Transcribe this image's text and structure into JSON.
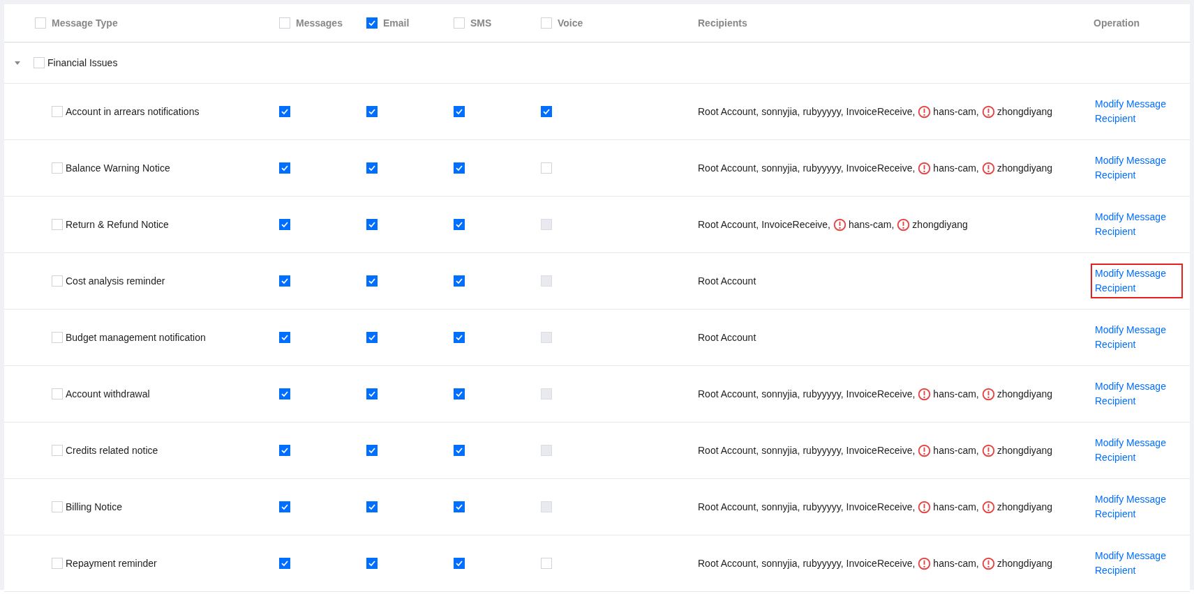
{
  "header": {
    "type": {
      "label": "Message Type",
      "checked": false
    },
    "channels": [
      {
        "label": "Messages",
        "checked": false
      },
      {
        "label": "Email",
        "checked": true
      },
      {
        "label": "SMS",
        "checked": false
      },
      {
        "label": "Voice",
        "checked": false
      }
    ],
    "recipients": "Recipients",
    "operation": "Operation"
  },
  "groups": [
    {
      "label": "Financial Issues",
      "expanded": true,
      "checked": false,
      "rows": [
        {
          "label": "Account in arrears notifications",
          "checked": false,
          "channels": [
            {
              "checked": true,
              "disabled": false
            },
            {
              "checked": true,
              "disabled": false
            },
            {
              "checked": true,
              "disabled": false
            },
            {
              "checked": true,
              "disabled": false
            }
          ],
          "recipients": [
            {
              "name": "Root Account,",
              "warning": false
            },
            {
              "name": "sonnyjia,",
              "warning": false
            },
            {
              "name": "rubyyyyy,",
              "warning": false
            },
            {
              "name": "InvoiceReceive,",
              "warning": false
            },
            {
              "name": "hans-cam,",
              "warning": true
            },
            {
              "name": "zhongdiyang",
              "warning": true
            }
          ],
          "operation": {
            "label": "Modify Message Recipient",
            "highlighted": false
          }
        },
        {
          "label": "Balance Warning Notice",
          "checked": false,
          "channels": [
            {
              "checked": true,
              "disabled": false
            },
            {
              "checked": true,
              "disabled": false
            },
            {
              "checked": true,
              "disabled": false
            },
            {
              "checked": false,
              "disabled": false
            }
          ],
          "recipients": [
            {
              "name": "Root Account,",
              "warning": false
            },
            {
              "name": "sonnyjia,",
              "warning": false
            },
            {
              "name": "rubyyyyy,",
              "warning": false
            },
            {
              "name": "InvoiceReceive,",
              "warning": false
            },
            {
              "name": "hans-cam,",
              "warning": true
            },
            {
              "name": "zhongdiyang",
              "warning": true
            }
          ],
          "operation": {
            "label": "Modify Message Recipient",
            "highlighted": false
          }
        },
        {
          "label": "Return & Refund Notice",
          "checked": false,
          "channels": [
            {
              "checked": true,
              "disabled": false
            },
            {
              "checked": true,
              "disabled": false
            },
            {
              "checked": true,
              "disabled": false
            },
            {
              "checked": false,
              "disabled": true
            }
          ],
          "recipients": [
            {
              "name": "Root Account,",
              "warning": false
            },
            {
              "name": "InvoiceReceive,",
              "warning": false
            },
            {
              "name": "hans-cam,",
              "warning": true
            },
            {
              "name": "zhongdiyang",
              "warning": true
            }
          ],
          "operation": {
            "label": "Modify Message Recipient",
            "highlighted": false
          }
        },
        {
          "label": "Cost analysis reminder",
          "checked": false,
          "channels": [
            {
              "checked": true,
              "disabled": false
            },
            {
              "checked": true,
              "disabled": false
            },
            {
              "checked": true,
              "disabled": false
            },
            {
              "checked": false,
              "disabled": true
            }
          ],
          "recipients": [
            {
              "name": "Root Account",
              "warning": false
            }
          ],
          "operation": {
            "label": "Modify Message Recipient",
            "highlighted": true
          }
        },
        {
          "label": "Budget management notification",
          "checked": false,
          "channels": [
            {
              "checked": true,
              "disabled": false
            },
            {
              "checked": true,
              "disabled": false
            },
            {
              "checked": true,
              "disabled": false
            },
            {
              "checked": false,
              "disabled": true
            }
          ],
          "recipients": [
            {
              "name": "Root Account",
              "warning": false
            }
          ],
          "operation": {
            "label": "Modify Message Recipient",
            "highlighted": false
          }
        },
        {
          "label": "Account withdrawal",
          "checked": false,
          "channels": [
            {
              "checked": true,
              "disabled": false
            },
            {
              "checked": true,
              "disabled": false
            },
            {
              "checked": true,
              "disabled": false
            },
            {
              "checked": false,
              "disabled": true
            }
          ],
          "recipients": [
            {
              "name": "Root Account,",
              "warning": false
            },
            {
              "name": "sonnyjia,",
              "warning": false
            },
            {
              "name": "rubyyyyy,",
              "warning": false
            },
            {
              "name": "InvoiceReceive,",
              "warning": false
            },
            {
              "name": "hans-cam,",
              "warning": true
            },
            {
              "name": "zhongdiyang",
              "warning": true
            }
          ],
          "operation": {
            "label": "Modify Message Recipient",
            "highlighted": false
          }
        },
        {
          "label": "Credits related notice",
          "checked": false,
          "channels": [
            {
              "checked": true,
              "disabled": false
            },
            {
              "checked": true,
              "disabled": false
            },
            {
              "checked": true,
              "disabled": false
            },
            {
              "checked": false,
              "disabled": true
            }
          ],
          "recipients": [
            {
              "name": "Root Account,",
              "warning": false
            },
            {
              "name": "sonnyjia,",
              "warning": false
            },
            {
              "name": "rubyyyyy,",
              "warning": false
            },
            {
              "name": "InvoiceReceive,",
              "warning": false
            },
            {
              "name": "hans-cam,",
              "warning": true
            },
            {
              "name": "zhongdiyang",
              "warning": true
            }
          ],
          "operation": {
            "label": "Modify Message Recipient",
            "highlighted": false
          }
        },
        {
          "label": "Billing Notice",
          "checked": false,
          "channels": [
            {
              "checked": true,
              "disabled": false
            },
            {
              "checked": true,
              "disabled": false
            },
            {
              "checked": true,
              "disabled": false
            },
            {
              "checked": false,
              "disabled": true
            }
          ],
          "recipients": [
            {
              "name": "Root Account,",
              "warning": false
            },
            {
              "name": "sonnyjia,",
              "warning": false
            },
            {
              "name": "rubyyyyy,",
              "warning": false
            },
            {
              "name": "InvoiceReceive,",
              "warning": false
            },
            {
              "name": "hans-cam,",
              "warning": true
            },
            {
              "name": "zhongdiyang",
              "warning": true
            }
          ],
          "operation": {
            "label": "Modify Message Recipient",
            "highlighted": false
          }
        },
        {
          "label": "Repayment reminder",
          "checked": false,
          "channels": [
            {
              "checked": true,
              "disabled": false
            },
            {
              "checked": true,
              "disabled": false
            },
            {
              "checked": true,
              "disabled": false
            },
            {
              "checked": false,
              "disabled": false
            }
          ],
          "recipients": [
            {
              "name": "Root Account,",
              "warning": false
            },
            {
              "name": "sonnyjia,",
              "warning": false
            },
            {
              "name": "rubyyyyy,",
              "warning": false
            },
            {
              "name": "InvoiceReceive,",
              "warning": false
            },
            {
              "name": "hans-cam,",
              "warning": true
            },
            {
              "name": "zhongdiyang",
              "warning": true
            }
          ],
          "operation": {
            "label": "Modify Message Recipient",
            "highlighted": false
          }
        }
      ]
    }
  ]
}
